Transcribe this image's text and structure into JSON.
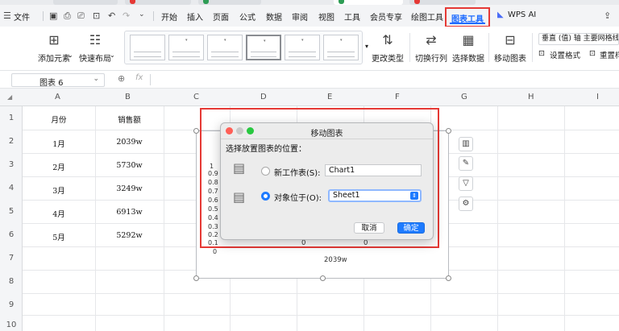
{
  "menubar": {
    "hamburger": "☰",
    "file": "文件",
    "tabs": [
      "开始",
      "插入",
      "页面",
      "公式",
      "数据",
      "审阅",
      "视图",
      "工具",
      "会员专享",
      "绘图工具"
    ],
    "active_tab": "图表工具",
    "wps_ai": "WPS AI"
  },
  "ribbon": {
    "add_element": "添加元素",
    "quick_layout": "快速布局",
    "change_type": "更改类型",
    "switch_row_col": "切换行列",
    "select_data": "选择数据",
    "move_chart": "移动图表",
    "axis_dropdown": "垂直 (值) 轴 主要网格线",
    "set_format": "设置格式",
    "reset_style": "重置样"
  },
  "formula_bar": {
    "name_box": "图表 6",
    "fx": "fx"
  },
  "sheet": {
    "columns": [
      "A",
      "B",
      "C",
      "D",
      "E",
      "F",
      "G",
      "H",
      "I"
    ],
    "rows": [
      "1",
      "2",
      "3",
      "4",
      "5",
      "6",
      "7",
      "8",
      "9",
      "10"
    ],
    "header_a": "月份",
    "header_b": "销售额",
    "data": [
      {
        "month": "1月",
        "sales": "2039w"
      },
      {
        "month": "2月",
        "sales": "5730w"
      },
      {
        "month": "3月",
        "sales": "3249w"
      },
      {
        "month": "4月",
        "sales": "6913w"
      },
      {
        "month": "5月",
        "sales": "5292w"
      }
    ]
  },
  "chart": {
    "y_ticks": [
      "1",
      "0.9",
      "0.8",
      "0.7",
      "0.6",
      "0.5",
      "0.4",
      "0.3",
      "0.2",
      "0.1",
      "0"
    ],
    "x_zero_labels": [
      "0",
      "0"
    ],
    "x_category": "2039w"
  },
  "dialog": {
    "title": "移动图表",
    "subtitle": "选择放置图表的位置：",
    "option_new_sheet": "新工作表(S):",
    "new_sheet_value": "Chart1",
    "option_object_in": "对象位于(O):",
    "object_in_value": "Sheet1",
    "cancel": "取消",
    "ok": "确定"
  },
  "colors": {
    "accent": "#1e7bff",
    "highlight": "#e53935"
  }
}
